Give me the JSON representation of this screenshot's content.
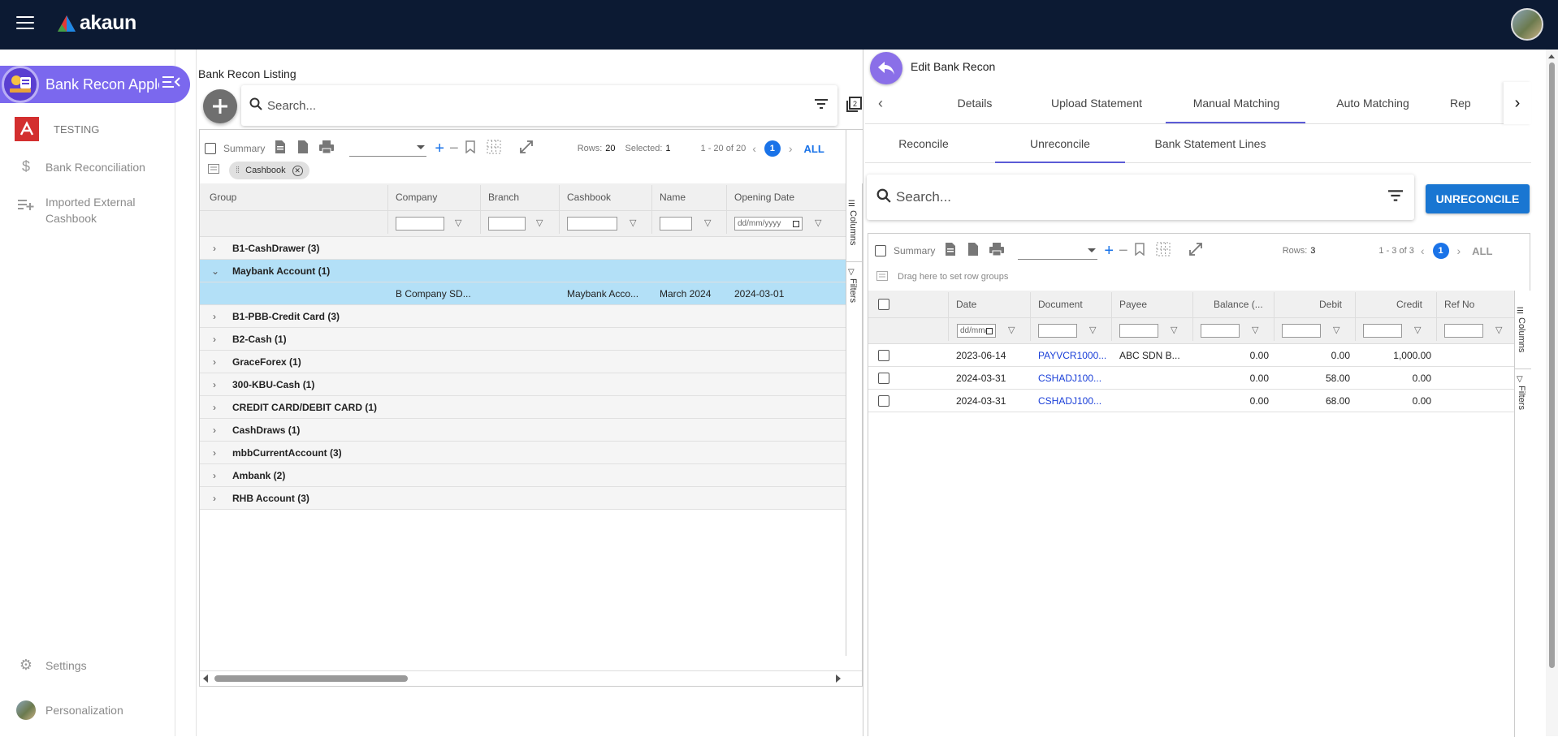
{
  "app": {
    "logo_text": "akaun"
  },
  "sidebar": {
    "app_name": "Bank Recon Apple",
    "org": "TESTING",
    "items": [
      {
        "label": "Bank Reconciliation",
        "icon": "dollar-icon"
      },
      {
        "label": "Imported External Cashbook",
        "icon": "playlist-add-icon"
      }
    ],
    "bottom": [
      {
        "label": "Settings",
        "icon": "gear-icon"
      },
      {
        "label": "Personalization",
        "icon": "avatar-icon"
      }
    ]
  },
  "left": {
    "title": "Bank Recon Listing",
    "search_placeholder": "Search...",
    "toolbar": {
      "summary": "Summary",
      "rows_label": "Rows:",
      "rows": "20",
      "selected_label": "Selected:",
      "selected": "1",
      "range": "1 - 20 of 20",
      "page": "1",
      "all": "ALL"
    },
    "group_chip": "Cashbook",
    "columns": [
      "Group",
      "Company",
      "Branch",
      "Cashbook",
      "Name",
      "Opening Date"
    ],
    "date_placeholder": "dd/mm/yyyy",
    "side_tabs": {
      "columns": "Columns",
      "filters": "Filters"
    },
    "groups": [
      {
        "label": "B1-CashDrawer (3)",
        "expanded": false
      },
      {
        "label": "Maybank Account (1)",
        "expanded": true,
        "child": {
          "company": "B Company SD...",
          "branch": "",
          "cashbook": "Maybank Acco...",
          "name": "March 2024",
          "opening_date": "2024-03-01"
        }
      },
      {
        "label": "B1-PBB-Credit Card (3)",
        "expanded": false
      },
      {
        "label": "B2-Cash (1)",
        "expanded": false
      },
      {
        "label": "GraceForex (1)",
        "expanded": false
      },
      {
        "label": "300-KBU-Cash (1)",
        "expanded": false
      },
      {
        "label": "CREDIT CARD/DEBIT CARD (1)",
        "expanded": false
      },
      {
        "label": "CashDraws (1)",
        "expanded": false
      },
      {
        "label": "mbbCurrentAccount (3)",
        "expanded": false
      },
      {
        "label": "Ambank (2)",
        "expanded": false
      },
      {
        "label": "RHB Account (3)",
        "expanded": false
      }
    ]
  },
  "right": {
    "title": "Edit Bank Recon",
    "tabs": [
      "Details",
      "Upload Statement",
      "Manual Matching",
      "Auto Matching",
      "Rep"
    ],
    "active_tab": "Manual Matching",
    "subtabs": [
      "Reconcile",
      "Unreconcile",
      "Bank Statement Lines"
    ],
    "active_subtab": "Unreconcile",
    "search_placeholder": "Search...",
    "action_button": "UNRECONCILE",
    "toolbar": {
      "summary": "Summary",
      "rows_label": "Rows:",
      "rows": "3",
      "range": "1 - 3 of 3",
      "page": "1",
      "all": "ALL"
    },
    "drag_hint": "Drag here to set row groups",
    "columns": [
      "Date",
      "Document",
      "Payee",
      "Balance (...",
      "Debit",
      "Credit",
      "Ref No"
    ],
    "date_placeholder": "dd/mm/yyyy",
    "side_tabs": {
      "columns": "Columns",
      "filters": "Filters"
    },
    "rows": [
      {
        "date": "2023-06-14",
        "document": "PAYVCR1000...",
        "payee": "ABC SDN B...",
        "balance": "0.00",
        "debit": "0.00",
        "credit": "1,000.00",
        "ref": ""
      },
      {
        "date": "2024-03-31",
        "document": "CSHADJ100...",
        "payee": "",
        "balance": "0.00",
        "debit": "58.00",
        "credit": "0.00",
        "ref": ""
      },
      {
        "date": "2024-03-31",
        "document": "CSHADJ100...",
        "payee": "",
        "balance": "0.00",
        "debit": "68.00",
        "credit": "0.00",
        "ref": ""
      }
    ]
  },
  "colors": {
    "topbar": "#0c1a33",
    "accent": "#7b68ee",
    "primary": "#1976d2",
    "selected_row": "#b3e0f7",
    "tab_underline": "#5b5bd6"
  }
}
